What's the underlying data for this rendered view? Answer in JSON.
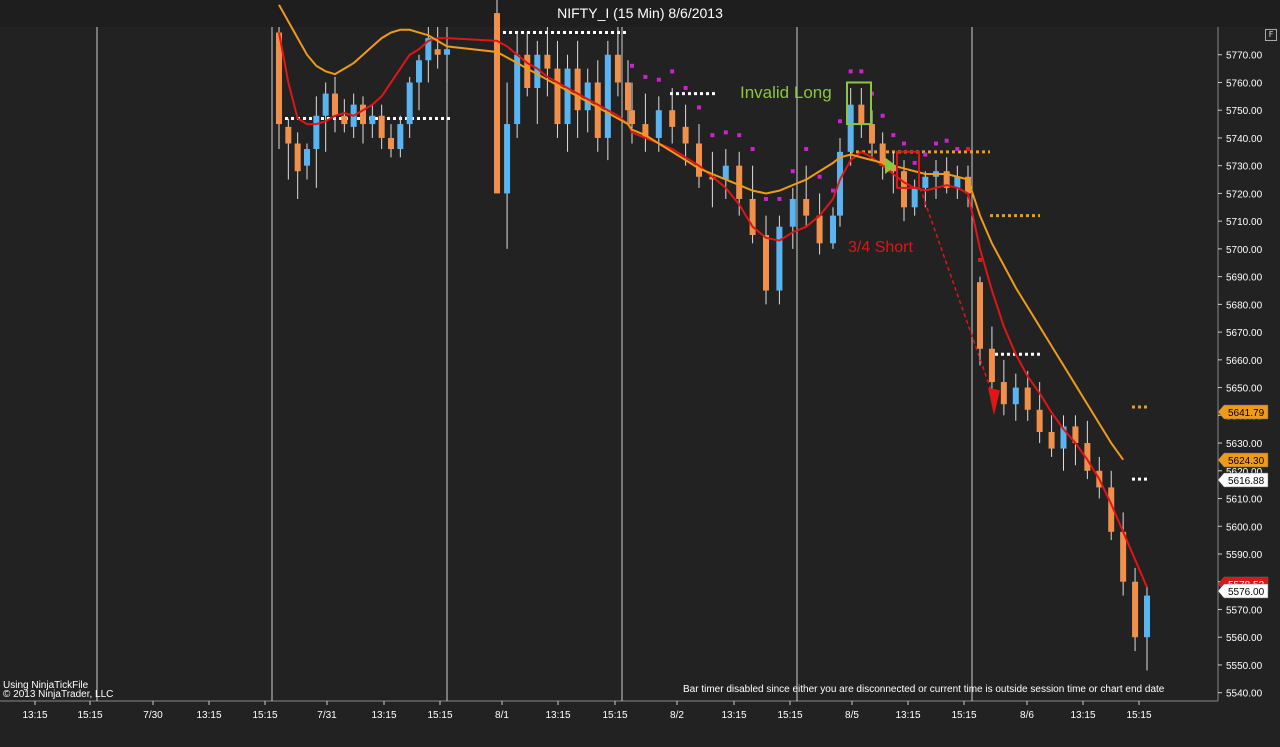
{
  "window": {
    "title": "NIFTY_I (15 Min)  8/6/2013",
    "corner_button": "F"
  },
  "footer": {
    "tickfile_note": "Using NinjaTickFile",
    "copyright": "© 2013 NinjaTrader, LLC",
    "bar_timer_note": "Bar timer disabled since either you are disconnected or current time is outside session time or chart end date"
  },
  "annotations": {
    "invalid_long": "Invalid Long",
    "short": "3/4 Short"
  },
  "colors": {
    "background": "#222222",
    "up_candle": "#5ab4f0",
    "down_candle": "#f0904a",
    "fast_ma": "#e01515",
    "slow_ma": "#f09a1a",
    "long_box": "#8cc63f",
    "short_box": "#e01515"
  },
  "chart_data": {
    "type": "candlestick",
    "title": "NIFTY_I (15 Min)  8/6/2013",
    "ylim": [
      5537,
      5780
    ],
    "y_ticks": [
      5540,
      5550,
      5560,
      5570,
      5580,
      5590,
      5600,
      5610,
      5620,
      5630,
      5640,
      5650,
      5660,
      5670,
      5680,
      5690,
      5700,
      5710,
      5720,
      5730,
      5740,
      5750,
      5760,
      5770
    ],
    "x_ticks": [
      "13:15",
      "15:15",
      "7/30",
      "13:15",
      "15:15",
      "7/31",
      "13:15",
      "15:15",
      "8/1",
      "13:15",
      "15:15",
      "8/2",
      "13:15",
      "15:15",
      "8/5",
      "13:15",
      "15:15",
      "8/6",
      "13:15",
      "15:15"
    ],
    "price_labels": [
      {
        "value": "5641.79",
        "color": "#f09a1a"
      },
      {
        "value": "5624.30",
        "color": "#f09a1a"
      },
      {
        "value": "5616.88",
        "color": "#ffffff"
      },
      {
        "value": "5578.53",
        "color": "#e01515"
      },
      {
        "value": "5576.00",
        "color": "#ffffff"
      }
    ],
    "candles": [
      [
        5778,
        5780,
        5736,
        5745
      ],
      [
        5744,
        5747,
        5725,
        5738
      ],
      [
        5738,
        5742,
        5718,
        5728
      ],
      [
        5730,
        5738,
        5725,
        5736
      ],
      [
        5736,
        5755,
        5722,
        5748
      ],
      [
        5748,
        5760,
        5735,
        5756
      ],
      [
        5756,
        5762,
        5742,
        5748
      ],
      [
        5748,
        5754,
        5742,
        5745
      ],
      [
        5744,
        5756,
        5740,
        5752
      ],
      [
        5752,
        5755,
        5738,
        5745
      ],
      [
        5745,
        5752,
        5740,
        5748
      ],
      [
        5748,
        5752,
        5736,
        5740
      ],
      [
        5740,
        5745,
        5733,
        5736
      ],
      [
        5736,
        5748,
        5733,
        5745
      ],
      [
        5745,
        5762,
        5740,
        5760
      ],
      [
        5760,
        5770,
        5750,
        5768
      ],
      [
        5768,
        5780,
        5760,
        5776
      ],
      [
        5772,
        5780,
        5765,
        5770
      ],
      [
        5770,
        5778,
        5760,
        5772
      ],
      [
        5785,
        5790,
        5750,
        5720
      ],
      [
        5720,
        5760,
        5700,
        5745
      ],
      [
        5745,
        5778,
        5740,
        5770
      ],
      [
        5770,
        5778,
        5755,
        5758
      ],
      [
        5758,
        5775,
        5745,
        5770
      ],
      [
        5770,
        5780,
        5755,
        5765
      ],
      [
        5765,
        5775,
        5740,
        5745
      ],
      [
        5745,
        5770,
        5735,
        5765
      ],
      [
        5765,
        5775,
        5740,
        5750
      ],
      [
        5750,
        5765,
        5742,
        5760
      ],
      [
        5760,
        5768,
        5735,
        5740
      ],
      [
        5740,
        5775,
        5732,
        5770
      ],
      [
        5770,
        5780,
        5755,
        5760
      ],
      [
        5760,
        5768,
        5745,
        5750
      ],
      [
        5750,
        5760,
        5738,
        5745
      ],
      [
        5745,
        5756,
        5735,
        5740
      ],
      [
        5740,
        5755,
        5735,
        5750
      ],
      [
        5750,
        5758,
        5738,
        5744
      ],
      [
        5744,
        5752,
        5730,
        5738
      ],
      [
        5738,
        5745,
        5722,
        5726
      ],
      [
        5726,
        5735,
        5715,
        5725
      ],
      [
        5725,
        5736,
        5718,
        5730
      ],
      [
        5730,
        5735,
        5712,
        5718
      ],
      [
        5718,
        5730,
        5702,
        5705
      ],
      [
        5705,
        5712,
        5680,
        5685
      ],
      [
        5685,
        5712,
        5680,
        5708
      ],
      [
        5708,
        5722,
        5700,
        5718
      ],
      [
        5718,
        5730,
        5708,
        5712
      ],
      [
        5712,
        5720,
        5698,
        5702
      ],
      [
        5702,
        5715,
        5700,
        5712
      ],
      [
        5712,
        5740,
        5708,
        5735
      ],
      [
        5735,
        5758,
        5730,
        5752
      ],
      [
        5752,
        5758,
        5740,
        5745
      ],
      [
        5745,
        5750,
        5732,
        5738
      ],
      [
        5738,
        5742,
        5725,
        5730
      ],
      [
        5730,
        5735,
        5720,
        5728
      ],
      [
        5728,
        5732,
        5710,
        5715
      ],
      [
        5715,
        5725,
        5712,
        5722
      ],
      [
        5722,
        5728,
        5715,
        5726
      ],
      [
        5726,
        5732,
        5718,
        5728
      ],
      [
        5728,
        5733,
        5720,
        5722
      ],
      [
        5722,
        5730,
        5718,
        5726
      ],
      [
        5726,
        5730,
        5715,
        5720
      ],
      [
        5688,
        5690,
        5658,
        5664
      ],
      [
        5664,
        5672,
        5648,
        5652
      ],
      [
        5652,
        5660,
        5640,
        5644
      ],
      [
        5644,
        5655,
        5638,
        5650
      ],
      [
        5650,
        5656,
        5638,
        5642
      ],
      [
        5642,
        5652,
        5630,
        5634
      ],
      [
        5634,
        5640,
        5625,
        5628
      ],
      [
        5628,
        5640,
        5620,
        5636
      ],
      [
        5636,
        5640,
        5622,
        5630
      ],
      [
        5630,
        5638,
        5617,
        5620
      ],
      [
        5620,
        5625,
        5610,
        5614
      ],
      [
        5614,
        5620,
        5595,
        5598
      ],
      [
        5598,
        5605,
        5575,
        5580
      ],
      [
        5580,
        5585,
        5555,
        5560
      ],
      [
        5560,
        5578,
        5548,
        5575
      ]
    ],
    "series": [
      {
        "name": "fast",
        "values": [
          5778,
          5760,
          5747,
          5745,
          5745,
          5746,
          5748,
          5749,
          5748,
          5750,
          5752,
          5755,
          5760,
          5765,
          5770,
          5772,
          5775,
          5776,
          5776,
          5775,
          5773,
          5770,
          5767,
          5765,
          5762,
          5760,
          5758,
          5756,
          5754,
          5752,
          5750,
          5748,
          5745,
          5742,
          5740,
          5738,
          5736,
          5733,
          5730,
          5726,
          5722,
          5716,
          5708,
          5704,
          5703,
          5706,
          5708,
          5712,
          5718,
          5725,
          5732,
          5735,
          5733,
          5730,
          5727,
          5724,
          5722,
          5721,
          5722,
          5723,
          5722,
          5720,
          5700,
          5685,
          5672,
          5662,
          5654,
          5648,
          5641,
          5635,
          5630,
          5624,
          5617,
          5608,
          5598,
          5588,
          5578
        ]
      },
      {
        "name": "slow",
        "values": [
          5788,
          5782,
          5776,
          5770,
          5766,
          5764,
          5763,
          5765,
          5767,
          5770,
          5773,
          5776,
          5778,
          5779,
          5779,
          5778,
          5777,
          5775,
          5773,
          5771,
          5769,
          5767,
          5765,
          5763,
          5761,
          5759,
          5757,
          5755,
          5753,
          5751,
          5749,
          5747,
          5745,
          5743,
          5741,
          5738,
          5735,
          5732,
          5729,
          5727,
          5725,
          5723,
          5721,
          5720,
          5721,
          5723,
          5725,
          5728,
          5731,
          5733,
          5734,
          5733,
          5732,
          5731,
          5730,
          5729,
          5728,
          5727,
          5727,
          5727,
          5726,
          5725,
          5712,
          5702,
          5694,
          5686,
          5679,
          5672,
          5665,
          5658,
          5651,
          5644,
          5637,
          5630,
          5624
        ]
      }
    ],
    "dotted_levels": [
      {
        "y": 5747,
        "color": "#ffffff"
      },
      {
        "y": 5778,
        "color": "#ffffff"
      },
      {
        "y": 5756,
        "color": "#ffffff"
      },
      {
        "y": 5735,
        "color": "#f09a1a"
      },
      {
        "y": 5712,
        "color": "#f09a1a"
      },
      {
        "y": 5662,
        "color": "#ffffff"
      },
      {
        "y": 5643,
        "color": "#f09a1a"
      },
      {
        "y": 5617,
        "color": "#ffffff"
      }
    ]
  }
}
